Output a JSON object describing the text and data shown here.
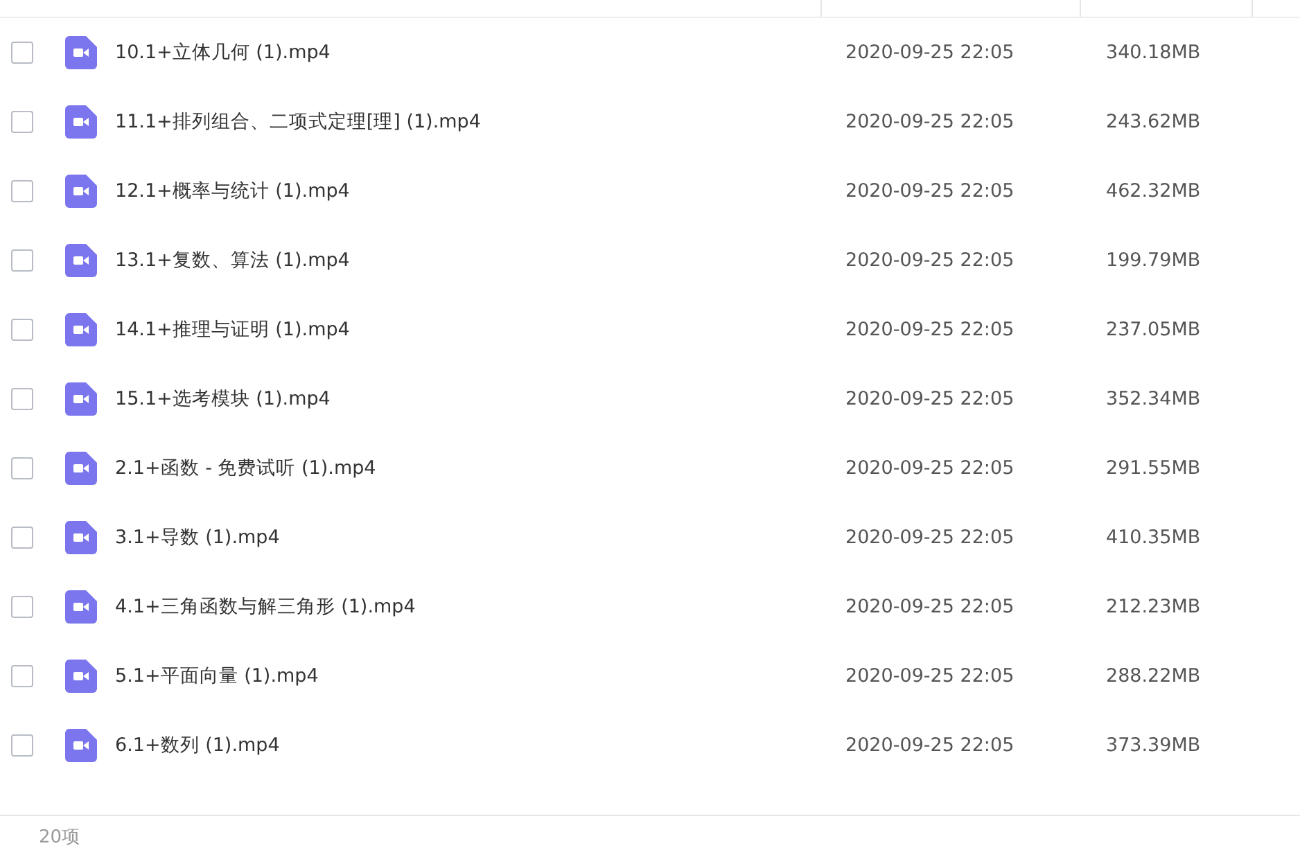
{
  "files": [
    {
      "name": "10.1+立体几何 (1).mp4",
      "modified": "2020-09-25 22:05",
      "size": "340.18MB",
      "checked": false
    },
    {
      "name": "11.1+排列组合、二项式定理[理] (1).mp4",
      "modified": "2020-09-25 22:05",
      "size": "243.62MB",
      "checked": false
    },
    {
      "name": "12.1+概率与统计 (1).mp4",
      "modified": "2020-09-25 22:05",
      "size": "462.32MB",
      "checked": false
    },
    {
      "name": "13.1+复数、算法 (1).mp4",
      "modified": "2020-09-25 22:05",
      "size": "199.79MB",
      "checked": false
    },
    {
      "name": "14.1+推理与证明 (1).mp4",
      "modified": "2020-09-25 22:05",
      "size": "237.05MB",
      "checked": false
    },
    {
      "name": "15.1+选考模块 (1).mp4",
      "modified": "2020-09-25 22:05",
      "size": "352.34MB",
      "checked": false
    },
    {
      "name": "2.1+函数 - 免费试听 (1).mp4",
      "modified": "2020-09-25 22:05",
      "size": "291.55MB",
      "checked": false
    },
    {
      "name": "3.1+导数 (1).mp4",
      "modified": "2020-09-25 22:05",
      "size": "410.35MB",
      "checked": false
    },
    {
      "name": "4.1+三角函数与解三角形 (1).mp4",
      "modified": "2020-09-25 22:05",
      "size": "212.23MB",
      "checked": false
    },
    {
      "name": "5.1+平面向量 (1).mp4",
      "modified": "2020-09-25 22:05",
      "size": "288.22MB",
      "checked": false
    },
    {
      "name": "6.1+数列 (1).mp4",
      "modified": "2020-09-25 22:05",
      "size": "373.39MB",
      "checked": false
    }
  ],
  "status_bar": {
    "count": "20项"
  }
}
